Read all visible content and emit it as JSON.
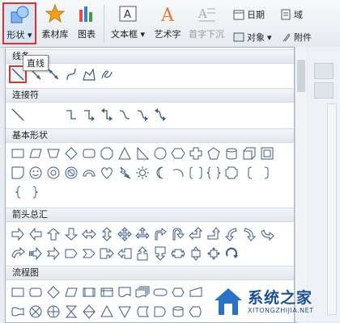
{
  "ribbon": {
    "shapes_label": "形状",
    "material_label": "素材库",
    "chart_label": "图表",
    "textbox_label": "文本框",
    "wordart_label": "艺术字",
    "dropcap_label": "首字下沉",
    "date_label": "日期",
    "field_label": "域",
    "object_label": "对象",
    "attachment_label": "附件",
    "wordart_glyph": "A",
    "textbox_glyph": "A"
  },
  "panel": {
    "sections": {
      "lines": "线条",
      "connectors": "连接符",
      "basic": "基本形状",
      "arrows": "箭头总汇",
      "flowchart": "流程图"
    },
    "tooltip": "直线"
  },
  "watermark": {
    "brand": "系统之家",
    "url": "XITONGZHIJIA.NET"
  },
  "colors": {
    "highlight_red": "#e03030",
    "icon_blue": "#2f6fc7",
    "shape_stroke": "#3d5a80"
  }
}
